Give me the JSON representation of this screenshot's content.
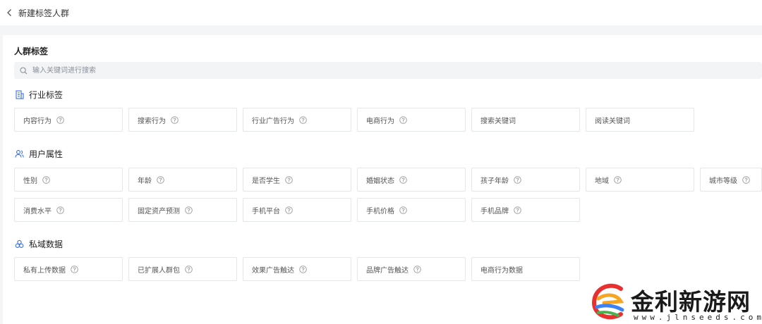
{
  "header": {
    "title": "新建标签人群",
    "back_icon": "chevron-left-icon"
  },
  "card": {
    "title": "人群标签",
    "search": {
      "placeholder": "输入关键词进行搜索",
      "value": "",
      "icon": "search-icon"
    }
  },
  "sections": {
    "industry": {
      "title": "行业标签",
      "icon": "building-icon",
      "tags": [
        {
          "label": "内容行为",
          "help": true
        },
        {
          "label": "搜索行为",
          "help": true
        },
        {
          "label": "行业广告行为",
          "help": true
        },
        {
          "label": "电商行为",
          "help": true
        },
        {
          "label": "搜索关键词",
          "help": false
        },
        {
          "label": "阅读关键词",
          "help": false
        }
      ]
    },
    "user": {
      "title": "用户属性",
      "icon": "users-icon",
      "tags": [
        {
          "label": "性别",
          "help": true
        },
        {
          "label": "年龄",
          "help": true
        },
        {
          "label": "是否学生",
          "help": true
        },
        {
          "label": "婚姻状态",
          "help": true
        },
        {
          "label": "孩子年龄",
          "help": true
        },
        {
          "label": "地域",
          "help": true
        },
        {
          "label": "城市等级",
          "help": true
        },
        {
          "label": "消费水平",
          "help": true
        },
        {
          "label": "固定资产预测",
          "help": true
        },
        {
          "label": "手机平台",
          "help": true
        },
        {
          "label": "手机价格",
          "help": true
        },
        {
          "label": "手机品牌",
          "help": true
        }
      ]
    },
    "private": {
      "title": "私域数据",
      "icon": "circles-icon",
      "tags": [
        {
          "label": "私有上传数据",
          "help": true
        },
        {
          "label": "已扩展人群包",
          "help": true
        },
        {
          "label": "效果广告触达",
          "help": true
        },
        {
          "label": "品牌广告触达",
          "help": true
        },
        {
          "label": "电商行为数据",
          "help": false
        }
      ]
    }
  },
  "watermark": {
    "name": "金利新游网",
    "url": "www.jlnseeds.com"
  },
  "colors": {
    "accent": "#3b6fe0",
    "border": "#e5e6eb",
    "search_bg": "#f3f4f6"
  }
}
